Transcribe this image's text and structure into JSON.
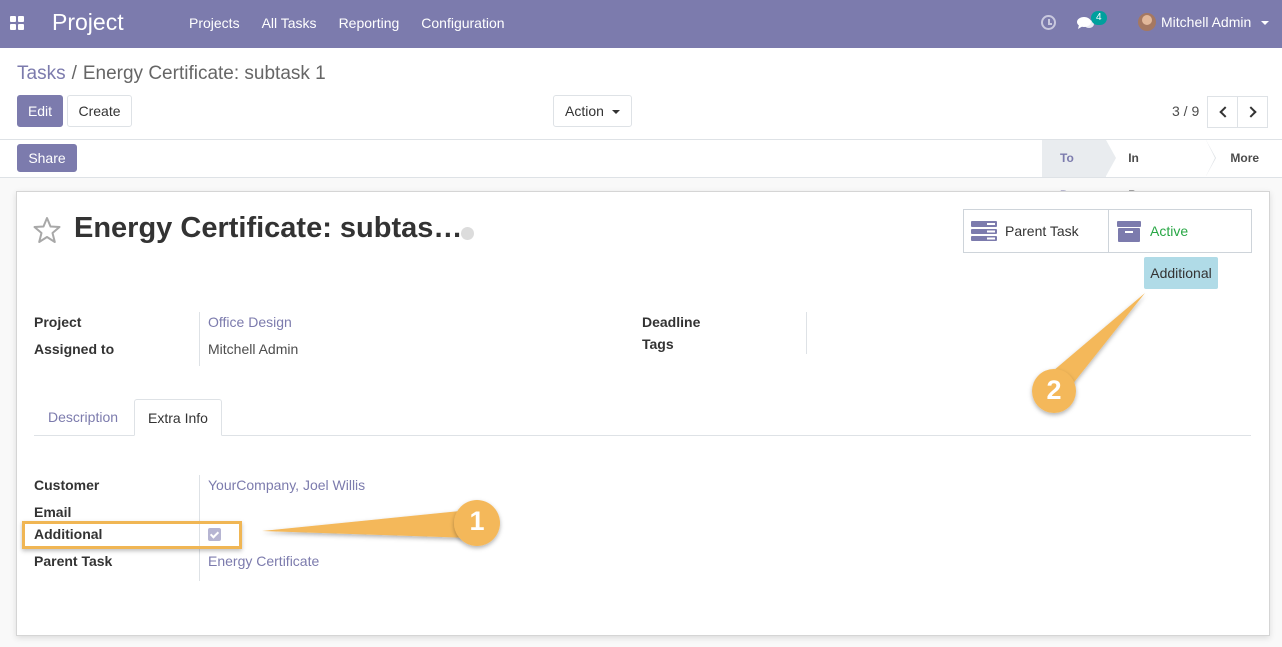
{
  "app": {
    "title": "Project"
  },
  "nav": {
    "items": [
      "Projects",
      "All Tasks",
      "Reporting",
      "Configuration"
    ],
    "chat_count": "4",
    "user_name": "Mitchell Admin"
  },
  "breadcrumb": {
    "parent": "Tasks",
    "separator": "/",
    "current": "Energy Certificate: subtask 1"
  },
  "buttons": {
    "edit": "Edit",
    "create": "Create",
    "action": "Action",
    "share": "Share"
  },
  "pager": {
    "value": "3 / 9"
  },
  "stages": {
    "todo": "To Do",
    "in_progress": "In Progress",
    "more": "More"
  },
  "form": {
    "title": "Energy Certificate: subtas…",
    "smart_buttons": {
      "parent_task": "Parent Task",
      "active": "Active"
    },
    "badge": "Additional",
    "fields": {
      "project_label": "Project",
      "project_value": "Office Design",
      "assigned_label": "Assigned to",
      "assigned_value": "Mitchell Admin",
      "deadline_label": "Deadline",
      "tags_label": "Tags"
    },
    "tabs": {
      "description": "Description",
      "extra_info": "Extra Info"
    },
    "extra": {
      "customer_label": "Customer",
      "customer_value": "YourCompany, Joel Willis",
      "email_label": "Email",
      "additional_label": "Additional",
      "additional_checked": true,
      "parent_label": "Parent Task",
      "parent_value": "Energy Certificate"
    }
  },
  "annotations": {
    "one": "1",
    "two": "2"
  },
  "colors": {
    "brand": "#7c7bad",
    "annotation": "#f0b654",
    "active": "#28a745",
    "badge": "#b0dbe7"
  }
}
